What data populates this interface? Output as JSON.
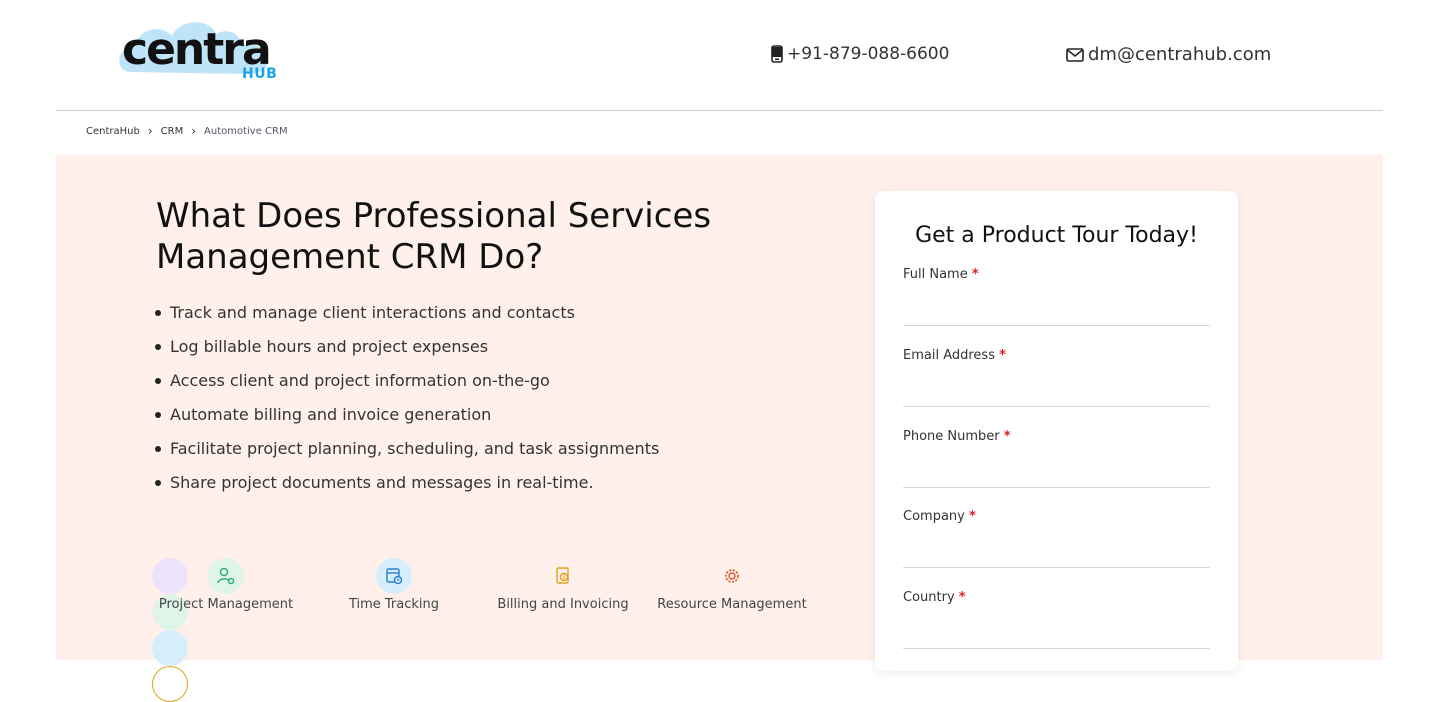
{
  "header": {
    "logo_text": "centra",
    "logo_sub": "HUB",
    "phone": "+91-879-088-6600",
    "email": "dm@centrahub.com"
  },
  "breadcrumb": [
    "CentraHub",
    "CRM",
    "Automotive CRM"
  ],
  "main": {
    "headline_line1": "What Does Professional Services",
    "headline_line2": "Management CRM Do?",
    "features": [
      "Track and manage client interactions and contacts",
      "Log billable hours and project expenses",
      "Access client and project information on-the-go",
      "Automate billing and invoice generation",
      "Facilitate project planning, scheduling, and task assignments",
      "Share project documents and messages in real-time."
    ],
    "services": [
      {
        "label": "Project Management",
        "icon": "user-gear-icon",
        "color": "#2fae6e"
      },
      {
        "label": "Time Tracking",
        "icon": "calendar-clock-icon",
        "color": "#2a7fd4"
      },
      {
        "label": "Billing and Invoicing",
        "icon": "invoice-dollar-icon",
        "color": "#e0a21c"
      },
      {
        "label": "Resource Management",
        "icon": "gear-icon",
        "color": "#e0552b"
      }
    ]
  },
  "form": {
    "title": "Get a Product Tour Today!",
    "required_mark": "*",
    "fields": [
      {
        "label": "Full Name",
        "value": ""
      },
      {
        "label": "Email Address",
        "value": ""
      },
      {
        "label": "Phone Number",
        "value": ""
      },
      {
        "label": "Company",
        "value": ""
      },
      {
        "label": "Country",
        "value": ""
      }
    ]
  },
  "colors": {
    "band_bg": "#fff0eb",
    "accent_blue": "#1aa3e8",
    "required_red": "#e02020"
  }
}
